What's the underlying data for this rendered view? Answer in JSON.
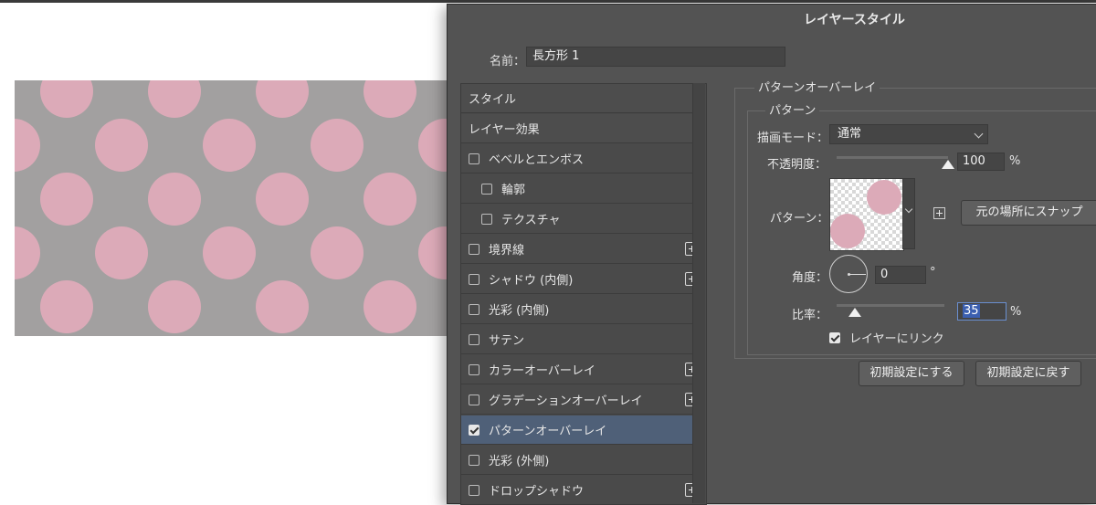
{
  "dialog": {
    "title": "レイヤースタイル",
    "name_label": "名前：",
    "name_value": "長方形 1"
  },
  "style_list": {
    "items": [
      {
        "label": "スタイル",
        "header": true
      },
      {
        "label": "レイヤー効果",
        "header": true
      },
      {
        "label": "ベベルとエンボス",
        "checked": false,
        "plus": false,
        "indent": 0
      },
      {
        "label": "輪郭",
        "checked": false,
        "plus": false,
        "indent": 1
      },
      {
        "label": "テクスチャ",
        "checked": false,
        "plus": false,
        "indent": 1
      },
      {
        "label": "境界線",
        "checked": false,
        "plus": true,
        "indent": 0
      },
      {
        "label": "シャドウ (内側)",
        "checked": false,
        "plus": true,
        "indent": 0
      },
      {
        "label": "光彩 (内側)",
        "checked": false,
        "plus": false,
        "indent": 0
      },
      {
        "label": "サテン",
        "checked": false,
        "plus": false,
        "indent": 0
      },
      {
        "label": "カラーオーバーレイ",
        "checked": false,
        "plus": true,
        "indent": 0
      },
      {
        "label": "グラデーションオーバーレイ",
        "checked": false,
        "plus": true,
        "indent": 0
      },
      {
        "label": "パターンオーバーレイ",
        "checked": true,
        "plus": false,
        "indent": 0,
        "selected": true
      },
      {
        "label": "光彩 (外側)",
        "checked": false,
        "plus": false,
        "indent": 0
      },
      {
        "label": "ドロップシャドウ",
        "checked": false,
        "plus": true,
        "indent": 0
      }
    ]
  },
  "settings": {
    "group_title": "パターンオーバーレイ",
    "sub_title": "パターン",
    "blend_mode_label": "描画モード：",
    "blend_mode_value": "通常",
    "opacity_label": "不透明度：",
    "opacity_value": "100",
    "opacity_percent": 100,
    "percent_sign": "%",
    "pattern_label": "パターン：",
    "snap_button": "元の場所にスナップ",
    "angle_label": "角度：",
    "angle_value": "0",
    "degree_sign": "°",
    "scale_label": "比率：",
    "scale_value": "35",
    "link_label": "レイヤーにリンク",
    "link_checked": true,
    "make_default_button": "初期設定にする",
    "reset_default_button": "初期設定に戻す"
  },
  "colors": {
    "canvas_bg": "#a2a0a0",
    "dot_pink": "#dcaab8",
    "dialog_bg": "#535353",
    "selected_row": "#4f6078"
  }
}
